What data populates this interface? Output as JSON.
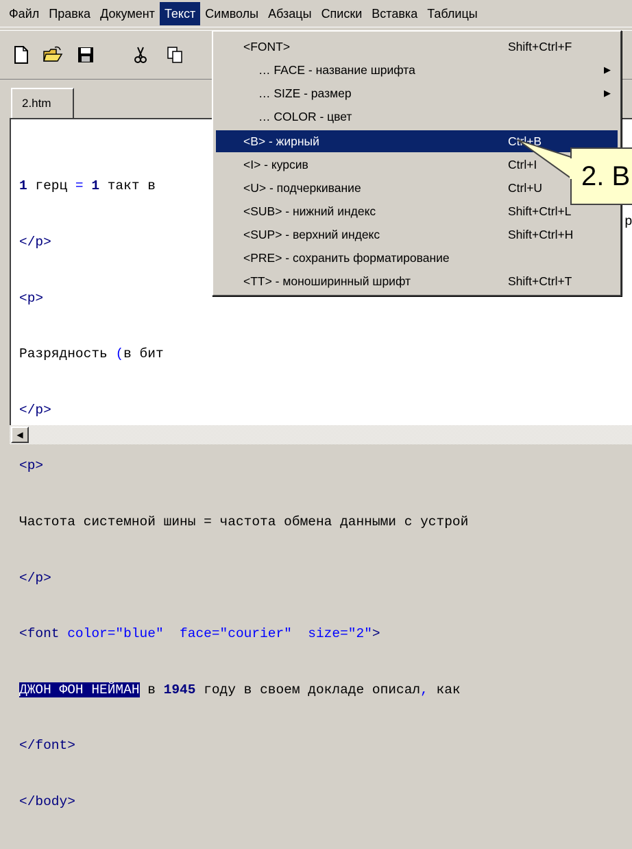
{
  "menubar": {
    "items": [
      "Файл",
      "Правка",
      "Документ",
      "Текст",
      "Символы",
      "Абзацы",
      "Списки",
      "Вставка",
      "Таблицы"
    ],
    "active_index": 3
  },
  "toolbar": {
    "icons": [
      "new-file-icon",
      "open-folder-icon",
      "save-disk-icon",
      "cut-scissors-icon",
      "copy-icon"
    ]
  },
  "tab": {
    "label": "2.htm"
  },
  "editor": {
    "lines": [
      "1 герц = 1 такт в",
      "</p>",
      "<p>",
      "Разрядность (в бит",
      "</p>",
      "<p>",
      "Частота системной шины = частота обмена данными с устрой",
      "</p>",
      "<font color=\"blue\"  face=\"courier\"  size=\"2\">",
      "ДЖОН ФОН НЕЙМАН в 1945 году в своем докладе описал, как",
      "</font>",
      "</body>"
    ],
    "right_fragments": {
      "line4": "р",
      "line7": "й"
    }
  },
  "text_menu": {
    "items": [
      {
        "label": "<FONT>",
        "shortcut": "Shift+Ctrl+F",
        "submenu": false,
        "indent": false
      },
      {
        "label": "… FACE - название шрифта",
        "shortcut": "",
        "submenu": true,
        "indent": true
      },
      {
        "label": "… SIZE - размер",
        "shortcut": "",
        "submenu": true,
        "indent": true
      },
      {
        "label": "… COLOR - цвет",
        "shortcut": "",
        "submenu": false,
        "indent": true
      },
      {
        "label": "<B> - жирный",
        "shortcut": "Ctrl+B",
        "submenu": false,
        "indent": false
      },
      {
        "label": "<I> - курсив",
        "shortcut": "Ctrl+I",
        "submenu": false,
        "indent": false
      },
      {
        "label": "<U> - подчеркивание",
        "shortcut": "Ctrl+U",
        "submenu": false,
        "indent": false
      },
      {
        "label": "<SUB> - нижний индекс",
        "shortcut": "Shift+Ctrl+L",
        "submenu": false,
        "indent": false
      },
      {
        "label": "<SUP> - верхний индекс",
        "shortcut": "Shift+Ctrl+H",
        "submenu": false,
        "indent": false
      },
      {
        "label": "<PRE> - сохранить форматирование",
        "shortcut": "",
        "submenu": false,
        "indent": false
      },
      {
        "label": "<TT> - моноширинный шрифт",
        "shortcut": "Shift+Ctrl+T",
        "submenu": false,
        "indent": false
      }
    ],
    "highlighted_index": 4
  },
  "callout": {
    "text": "2. В"
  },
  "colors": {
    "menu_highlight": "#0a246a",
    "selection": "#000080",
    "callout_bg": "#ffffcc"
  }
}
